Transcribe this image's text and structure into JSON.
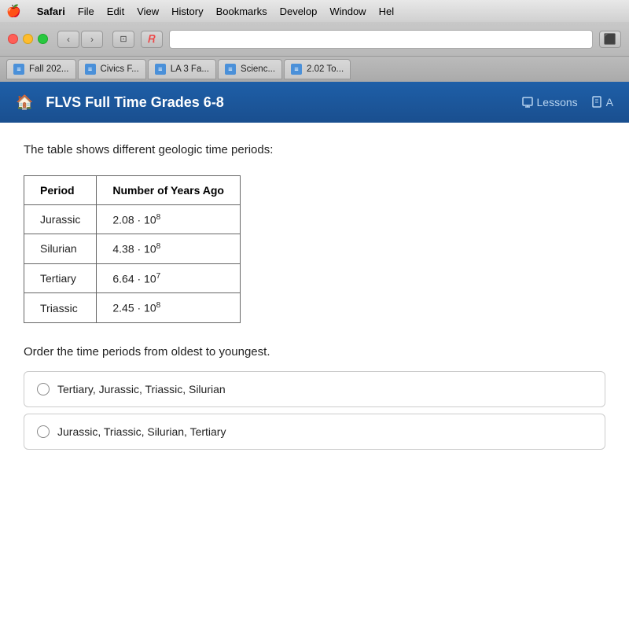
{
  "menubar": {
    "apple": "🍎",
    "items": [
      "Safari",
      "File",
      "Edit",
      "View",
      "History",
      "Bookmarks",
      "Develop",
      "Window",
      "Hel"
    ]
  },
  "toolbar": {
    "back_label": "‹",
    "forward_label": "›",
    "sidebar_label": "⊡",
    "reader_label": "R",
    "share_label": "↑"
  },
  "tabs": [
    {
      "label": "Fall 202..."
    },
    {
      "label": "Civics F..."
    },
    {
      "label": "LA 3 Fa..."
    },
    {
      "label": "Scienc..."
    },
    {
      "label": "2.02 To..."
    }
  ],
  "flvs": {
    "title": "FLVS Full Time Grades 6-8",
    "lessons_label": "Lessons",
    "assignments_label": "A"
  },
  "page": {
    "intro_text": "The table shows different geologic time periods:",
    "table": {
      "col1_header": "Period",
      "col2_header": "Number of Years Ago",
      "rows": [
        {
          "period": "Jurassic",
          "coefficient": "2.08",
          "dot": "·",
          "base": "10",
          "exponent": "8"
        },
        {
          "period": "Silurian",
          "coefficient": "4.38",
          "dot": "·",
          "base": "10",
          "exponent": "8"
        },
        {
          "period": "Tertiary",
          "coefficient": "6.64",
          "dot": "·",
          "base": "10",
          "exponent": "7"
        },
        {
          "period": "Triassic",
          "coefficient": "2.45",
          "dot": "·",
          "base": "10",
          "exponent": "8"
        }
      ]
    },
    "order_question": "Order the time periods from oldest to youngest.",
    "answers": [
      {
        "text": "Tertiary, Jurassic, Triassic, Silurian"
      },
      {
        "text": "Jurassic, Triassic, Silurian, Tertiary"
      }
    ]
  }
}
